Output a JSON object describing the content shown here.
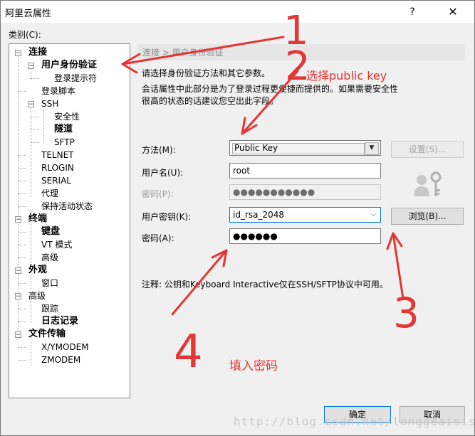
{
  "window": {
    "title": "阿里云属性",
    "help_glyph": "?",
    "close_glyph": "✕"
  },
  "category_label": "类别(C):",
  "tree": [
    {
      "id": "connect",
      "label": "连接",
      "bold": true,
      "expander": "−"
    },
    {
      "id": "auth",
      "label": "用户身份验证",
      "bold": true,
      "expander": "−"
    },
    {
      "id": "login-prompt",
      "label": "登录提示符",
      "bold": false
    },
    {
      "id": "login-script",
      "label": "登录脚本",
      "bold": false
    },
    {
      "id": "ssh",
      "label": "SSH",
      "bold": false,
      "expander": "−"
    },
    {
      "id": "security",
      "label": "安全性",
      "bold": false
    },
    {
      "id": "tunnel",
      "label": "隧道",
      "bold": true
    },
    {
      "id": "sftp",
      "label": "SFTP",
      "bold": false
    },
    {
      "id": "telnet",
      "label": "TELNET",
      "bold": false
    },
    {
      "id": "rlogin",
      "label": "RLOGIN",
      "bold": false
    },
    {
      "id": "serial",
      "label": "SERIAL",
      "bold": false
    },
    {
      "id": "proxy",
      "label": "代理",
      "bold": false
    },
    {
      "id": "keepalive",
      "label": "保持活动状态",
      "bold": false
    },
    {
      "id": "terminal",
      "label": "终端",
      "bold": true,
      "expander": "−"
    },
    {
      "id": "keyboard",
      "label": "键盘",
      "bold": true
    },
    {
      "id": "vt",
      "label": "VT 模式",
      "bold": false
    },
    {
      "id": "advanced1",
      "label": "高级",
      "bold": false
    },
    {
      "id": "appearance",
      "label": "外观",
      "bold": true,
      "expander": "−"
    },
    {
      "id": "window",
      "label": "窗口",
      "bold": false
    },
    {
      "id": "advanced2",
      "label": "高级",
      "bold": false,
      "expander": "−"
    },
    {
      "id": "trace",
      "label": "跟踪",
      "bold": false
    },
    {
      "id": "logging",
      "label": "日志记录",
      "bold": true
    },
    {
      "id": "filetransfer",
      "label": "文件传输",
      "bold": true,
      "expander": "−"
    },
    {
      "id": "xymodem",
      "label": "X/YMODEM",
      "bold": false
    },
    {
      "id": "zmodem",
      "label": "ZMODEM",
      "bold": false
    }
  ],
  "section_header": "连接 > 用户身份验证",
  "desc_line1": "请选择身份验证方法和其它参数。",
  "desc_line2": "会话属性中此部分是为了登录过程更便捷而提供的。如果需要安全性",
  "desc_line3": "很高的状态的话建议您空出此字段。",
  "form": {
    "method_label": "方法(M):",
    "method_value": "Public Key",
    "username_label": "用户名(U):",
    "username_value": "root",
    "password_label": "密码(P):",
    "password_value": "●●●●●●●●●●●",
    "userkey_label": "用户密钥(K):",
    "userkey_value": "id_rsa_2048",
    "passphrase_label": "密码(A):",
    "passphrase_value": "●●●●●●"
  },
  "buttons": {
    "settings": "设置(S)...",
    "browse": "浏览(B)...",
    "ok": "确定",
    "cancel": "取消"
  },
  "note": "注释: 公钥和Keyboard Interactive仅在SSH/SFTP协议中可用。",
  "annotations": {
    "n1": "1",
    "n2": "2",
    "n3": "3",
    "n4": "4",
    "select_public_key": "选择public key",
    "enter_password": "填入密码"
  },
  "watermark": "http://blog.csdn.net/longgeaisisi",
  "colors": {
    "annotation": "#e53535",
    "focus": "#0078d7"
  }
}
